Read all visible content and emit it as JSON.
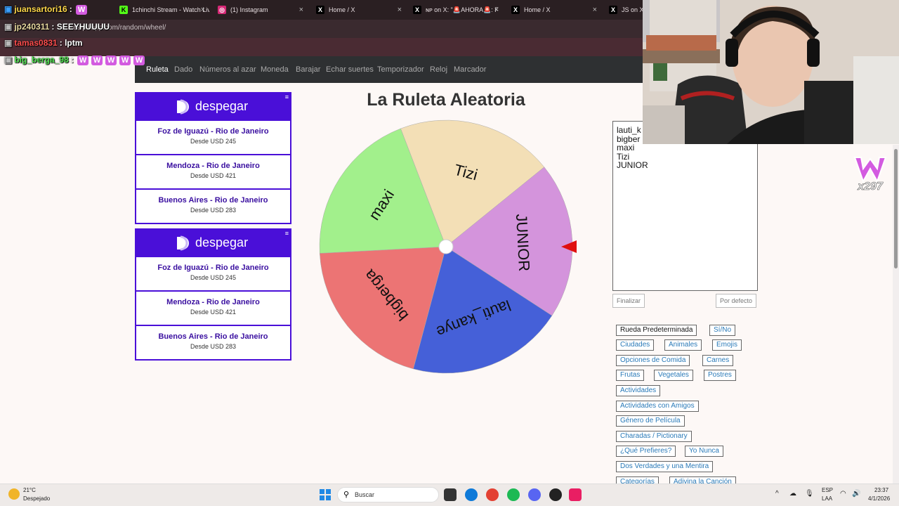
{
  "browser": {
    "tabs": [
      {
        "label": "1chinchi Stream - Watch Liv",
        "icon": "kick-icon",
        "color": "#53fc18"
      },
      {
        "label": "(1) Instagram",
        "icon": "instagram-icon",
        "color": "#d62976"
      },
      {
        "label": "Home / X",
        "icon": "x-icon",
        "color": "#ffffff"
      },
      {
        "label": "ɴᴘ on X: \"🚨AHORA🚨: F",
        "icon": "x-icon",
        "color": "#ffffff"
      },
      {
        "label": "Home / X",
        "icon": "x-icon",
        "color": "#ffffff"
      },
      {
        "label": "JS on X: \"",
        "icon": "x-icon",
        "color": "#ffffff"
      }
    ],
    "url": "es.piliapp.com/random/wheel/"
  },
  "chat": [
    {
      "user": "juansartori16",
      "message": "",
      "user_color": "#ffd84a",
      "emotes": 1
    },
    {
      "user": "jp240311",
      "message": "SEEYHUUUU",
      "user_color": "#e8d9a0",
      "emotes": 0
    },
    {
      "user": "tamas0831",
      "message": "lptm",
      "user_color": "#ff4d4d",
      "emotes": 0
    },
    {
      "user": "big_berga_98",
      "message": "",
      "user_color": "#4ee24e",
      "emotes": 5
    }
  ],
  "nav": [
    "Ruleta",
    "Dado",
    "Números al azar",
    "Moneda",
    "Barajar",
    "Echar suertes",
    "Temporizador",
    "Reloj",
    "Marcador"
  ],
  "ads": [
    {
      "brand": "despegar",
      "items": [
        {
          "route": "Foz de Iguazú - Rio de Janeiro",
          "price": "Desde USD 245"
        },
        {
          "route": "Mendoza - Rio de Janeiro",
          "price": "Desde USD 421"
        },
        {
          "route": "Buenos Aires - Rio de Janeiro",
          "price": "Desde USD 283"
        }
      ]
    },
    {
      "brand": "despegar",
      "items": [
        {
          "route": "Foz de Iguazú - Rio de Janeiro",
          "price": "Desde USD 245"
        },
        {
          "route": "Mendoza - Rio de Janeiro",
          "price": "Desde USD 421"
        },
        {
          "route": "Buenos Aires - Rio de Janeiro",
          "price": "Desde USD 283"
        }
      ]
    }
  ],
  "page_title": "La Ruleta Aleatoria",
  "wheel": {
    "segments": [
      {
        "label": "lauti_kanye",
        "color": "#4560d8"
      },
      {
        "label": "bigberga",
        "color": "#ec7474"
      },
      {
        "label": "maxi",
        "color": "#a2f08c"
      },
      {
        "label": "Tizi",
        "color": "#f3dfb6"
      },
      {
        "label": "JUNIOR",
        "color": "#d494dc"
      }
    ],
    "pointer_color": "#e01010"
  },
  "names_text": [
    "lauti_k",
    "bigber",
    "maxi",
    "Tizi",
    "JUNIOR"
  ],
  "buttons": {
    "finish": "Finalizar",
    "default": "Por defecto"
  },
  "presets": [
    "Rueda Predeterminada",
    "Sí/No",
    "Ciudades",
    "Animales",
    "Emojis",
    "Opciones de Comida",
    "Carnes",
    "Frutas",
    "Vegetales",
    "Postres",
    "Actividades",
    "Actividades con Amigos",
    "Género de Película",
    "Charadas / Pictionary",
    "¿Qué Prefieres?",
    "Yo Nunca",
    "Dos Verdades y una Mentira",
    "Categorías",
    "Adivina la Canción"
  ],
  "overlay_badge": "x297",
  "taskbar": {
    "weather_temp": "21°C",
    "weather_desc": "Despejado",
    "search_placeholder": "Buscar",
    "lang_top": "ESP",
    "lang_bottom": "LAA",
    "time": "23:37",
    "date": "4/1/2026"
  }
}
